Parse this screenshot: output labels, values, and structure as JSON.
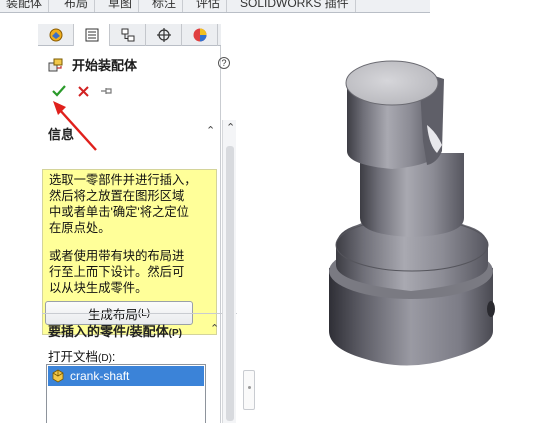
{
  "top_tabs": [
    "装配体",
    "布局",
    "草图",
    "标注",
    "评估",
    "SOLIDWORKS 插件"
  ],
  "panel_tabs": [
    {
      "icon": "feature-manager-icon",
      "active": false
    },
    {
      "icon": "property-manager-icon",
      "active": true
    },
    {
      "icon": "configuration-manager-icon",
      "active": false
    },
    {
      "icon": "dimxpert-icon",
      "active": false
    },
    {
      "icon": "display-manager-icon",
      "active": false
    }
  ],
  "property_manager": {
    "title": "开始装配体",
    "help": "?",
    "actions": {
      "ok": "confirm-check-icon",
      "cancel": "cancel-x-icon",
      "pin": "pin-icon"
    }
  },
  "info_group": {
    "title": "信息",
    "text_lines_1": [
      "选取一零部件并进行插入，",
      "然后将之放置在图形区域",
      "中或者单击'确定'将之定位",
      "在原点处。"
    ],
    "text_lines_2": [
      "或者使用带有块的布局进",
      "行至上而下设计。然后可",
      "以从块生成零件。"
    ],
    "button_label": "生成布局",
    "button_shortcut": "(L)"
  },
  "insert_group": {
    "title": "要插入的零件/装配体",
    "title_shortcut": "(P)",
    "open_label": "打开文档",
    "open_shortcut": "(D)",
    "documents": [
      "crank-shaft"
    ]
  },
  "colors": {
    "info_bg": "#ffff99",
    "selection": "#3b83d8",
    "ok_green": "#2a9a2a",
    "cancel_red": "#d22222",
    "pointer_red": "#e0201c",
    "part_gray": "#8a8a90"
  }
}
